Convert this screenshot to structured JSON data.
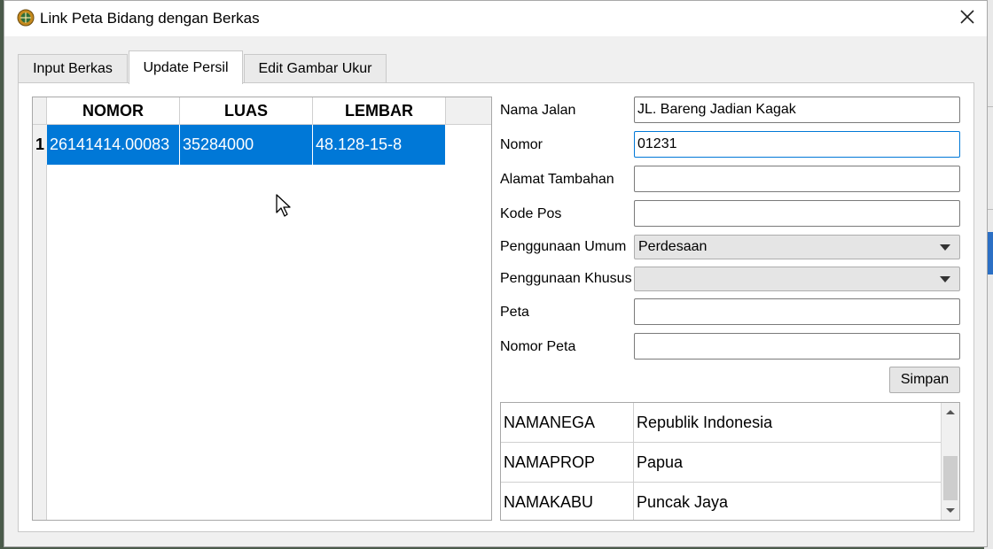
{
  "window": {
    "title": "Link Peta Bidang dengan Berkas",
    "close_label": "×"
  },
  "tabs": [
    {
      "label": "Input Berkas",
      "active": false
    },
    {
      "label": "Update Persil",
      "active": true
    },
    {
      "label": "Edit Gambar Ukur",
      "active": false
    }
  ],
  "grid": {
    "columns": [
      "NOMOR",
      "LUAS",
      "LEMBAR"
    ],
    "rows": [
      {
        "num": "1",
        "nomor": "26141414.00083",
        "luas": "35284000",
        "lembar": "48.128-15-8"
      }
    ],
    "selected_row_color": "#0078d7"
  },
  "form": {
    "nama_jalan": {
      "label": "Nama Jalan",
      "value": "JL. Bareng Jadian Kagak"
    },
    "nomor": {
      "label": "Nomor",
      "value": "01231"
    },
    "alamat_tambahan": {
      "label": "Alamat Tambahan",
      "value": ""
    },
    "kode_pos": {
      "label": "Kode Pos",
      "value": ""
    },
    "penggunaan_umum": {
      "label": "Penggunaan Umum",
      "value": "Perdesaan"
    },
    "penggunaan_khusus": {
      "label": "Penggunaan Khusus",
      "value": ""
    },
    "peta": {
      "label": "Peta",
      "value": ""
    },
    "nomor_peta": {
      "label": "Nomor Peta",
      "value": ""
    },
    "simpan_label": "Simpan"
  },
  "properties": [
    {
      "key": "NAMANEGA",
      "value": "Republik Indonesia"
    },
    {
      "key": "NAMAPROP",
      "value": "Papua"
    },
    {
      "key": "NAMAKABU",
      "value": "Puncak Jaya"
    }
  ],
  "icons": {
    "app": "globe-map-icon",
    "close": "close-icon",
    "dropdown": "chevron-down-icon",
    "scroll_up": "scroll-up-icon",
    "scroll_down": "scroll-down-icon",
    "cursor": "mouse-pointer-icon"
  }
}
